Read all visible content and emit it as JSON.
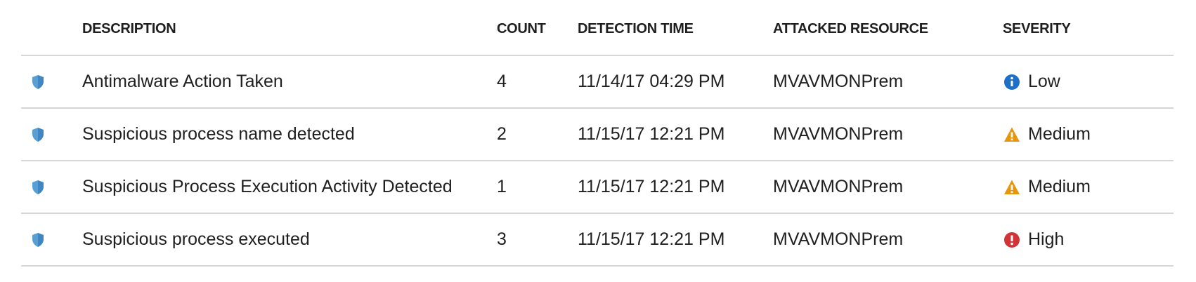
{
  "columns": {
    "description": "DESCRIPTION",
    "count": "COUNT",
    "detection_time": "DETECTION TIME",
    "attacked_resource": "ATTACKED RESOURCE",
    "severity": "SEVERITY"
  },
  "rows": [
    {
      "icon": "shield-icon",
      "description": "Antimalware Action Taken",
      "count": "4",
      "detection_time": "11/14/17 04:29 PM",
      "attacked_resource": "MVAVMONPrem",
      "severity": "Low",
      "severity_icon": "info-icon"
    },
    {
      "icon": "shield-icon",
      "description": "Suspicious process name detected",
      "count": "2",
      "detection_time": "11/15/17 12:21 PM",
      "attacked_resource": "MVAVMONPrem",
      "severity": "Medium",
      "severity_icon": "warning-icon"
    },
    {
      "icon": "shield-icon",
      "description": "Suspicious Process Execution Activity Detected",
      "count": "1",
      "detection_time": "11/15/17 12:21 PM",
      "attacked_resource": "MVAVMONPrem",
      "severity": "Medium",
      "severity_icon": "warning-icon"
    },
    {
      "icon": "shield-icon",
      "description": "Suspicious process executed",
      "count": "3",
      "detection_time": "11/15/17 12:21 PM",
      "attacked_resource": "MVAVMONPrem",
      "severity": "High",
      "severity_icon": "error-icon"
    }
  ],
  "colors": {
    "shield": "#5a9fd4",
    "low": "#1e6fc9",
    "medium": "#e8950c",
    "high": "#d13438",
    "divider": "#d6d6d6"
  }
}
